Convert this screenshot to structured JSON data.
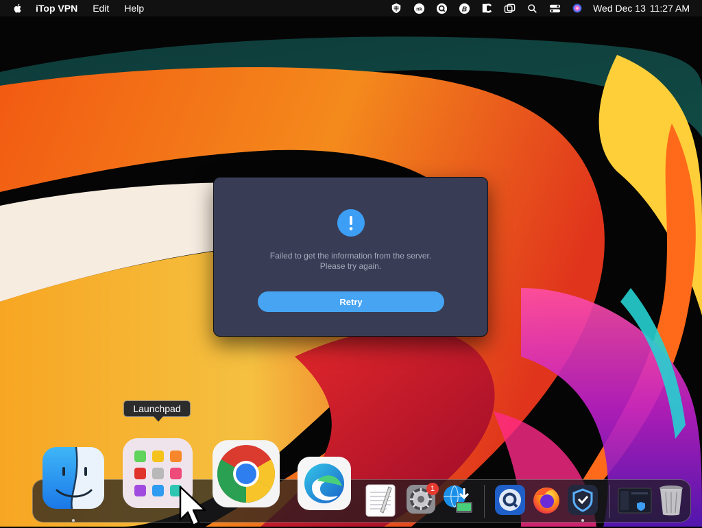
{
  "menubar": {
    "app_name": "iTop VPN",
    "menus": [
      "Edit",
      "Help"
    ],
    "date": "Wed Dec 13",
    "time": "11:27 AM",
    "status_icons": [
      "shield-grid-icon",
      "nk-circle-icon",
      "q-circle-icon",
      "b-circle-icon",
      "c-half-icon",
      "overlap-squares-icon",
      "search-icon",
      "control-center-icon",
      "siri-icon"
    ]
  },
  "dialog": {
    "icon": "exclamation-icon",
    "message_line1": "Failed to get the information from the server.",
    "message_line2": "Please try again.",
    "retry_label": "Retry"
  },
  "tooltip": {
    "label": "Launchpad"
  },
  "dock": {
    "items": [
      "Finder",
      "Launchpad",
      "Google Chrome",
      "Microsoft Edge",
      "TextEdit",
      "System Preferences",
      "Network Radar",
      "Quik",
      "Firefox",
      "iTop VPN",
      "Screen Thumbnail",
      "Trash"
    ],
    "system_prefs_badge": "1"
  },
  "colors": {
    "dialog_bg": "#383c54",
    "accent_blue": "#46a4f3",
    "message_text": "#a7abbe"
  }
}
